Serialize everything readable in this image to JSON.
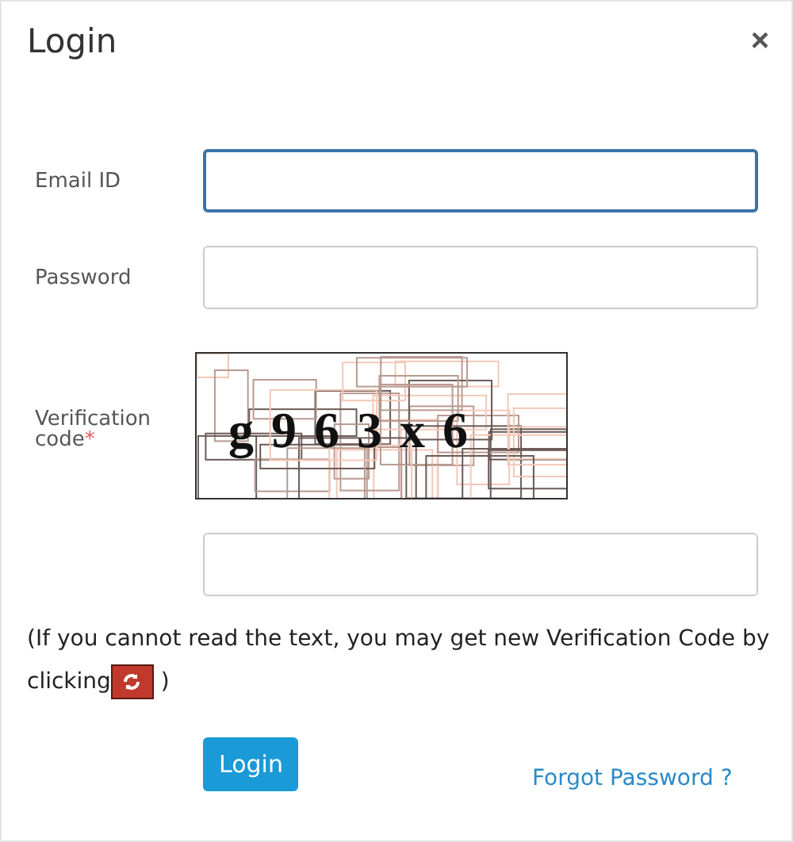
{
  "dialog": {
    "title": "Login",
    "close": "×"
  },
  "fields": [
    {
      "label": "Email ID",
      "focused": true
    },
    {
      "label": "Password",
      "focused": false
    }
  ],
  "captcha": {
    "label": "Verification code",
    "required": true,
    "required_mark": "*",
    "text": "g963x6"
  },
  "captcha_field": {
    "focused": false
  },
  "help": {
    "before": "(If you cannot read the text, you may get new Verification Code by clicking",
    "after": ")"
  },
  "login_button": "Login",
  "forgot_link": "Forgot Password ?"
}
